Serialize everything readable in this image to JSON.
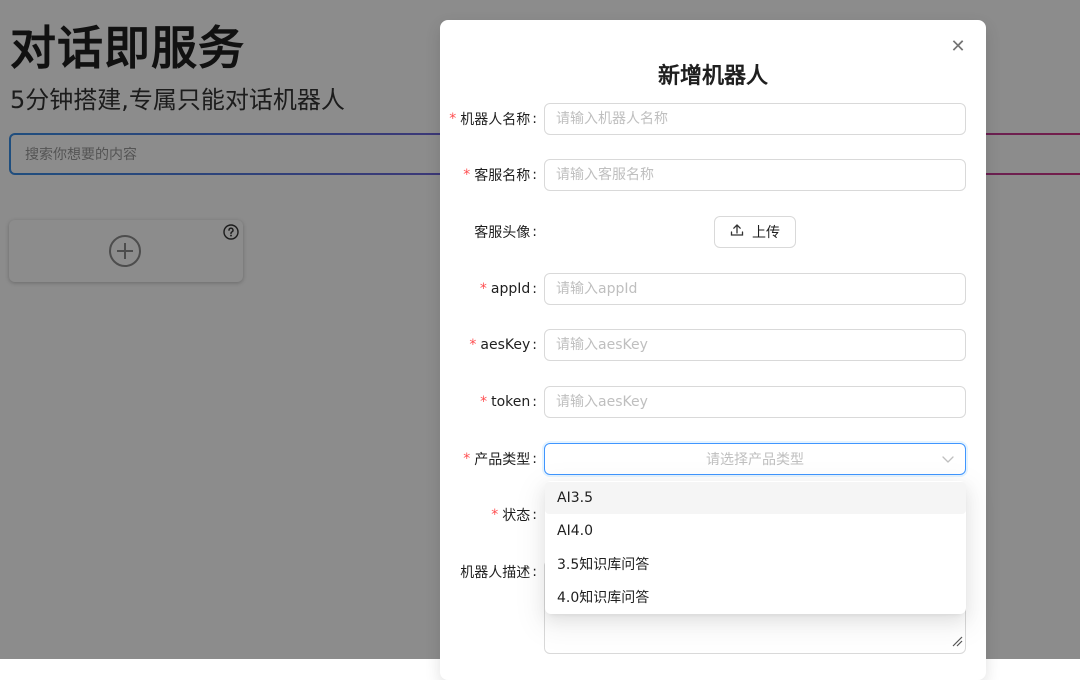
{
  "hero": {
    "title": "对话即服务",
    "subtitle": "5分钟搭建,专属只能对话机器人"
  },
  "search": {
    "placeholder": "搜索你想要的内容"
  },
  "add_card": {
    "plus_icon": "plus-circle-icon",
    "help_icon": "question-circle-icon"
  },
  "modal": {
    "title": "新增机器人",
    "close_icon": "close-icon",
    "close_glyph": "✕",
    "fields": {
      "robot_name": {
        "label": "机器人名称",
        "placeholder": "请输入机器人名称",
        "required": true
      },
      "service_name": {
        "label": "客服名称",
        "placeholder": "请输入客服名称",
        "required": true
      },
      "avatar": {
        "label": "客服头像",
        "button": "上传",
        "required": false
      },
      "appid": {
        "label": "appId",
        "placeholder": "请输入appId",
        "required": true
      },
      "aeskey": {
        "label": "aesKey",
        "placeholder": "请输入aesKey",
        "required": true
      },
      "token": {
        "label": "token",
        "placeholder": "请输入aesKey",
        "required": true
      },
      "product_type": {
        "label": "产品类型",
        "placeholder": "请选择产品类型",
        "required": true
      },
      "status": {
        "label": "状态",
        "required": true
      },
      "description": {
        "label": "机器人描述",
        "required": false
      }
    },
    "required_mark": "*",
    "colon": ":"
  },
  "dropdown": {
    "options": [
      "AI3.5",
      "AI4.0",
      "3.5知识库问答",
      "4.0知识库问答"
    ],
    "active_index": 0
  },
  "colors": {
    "required": "#ff4d4f",
    "primary": "#4096ff",
    "placeholder": "#bfbfbf",
    "mask": "rgba(0,0,0,0.45)"
  }
}
